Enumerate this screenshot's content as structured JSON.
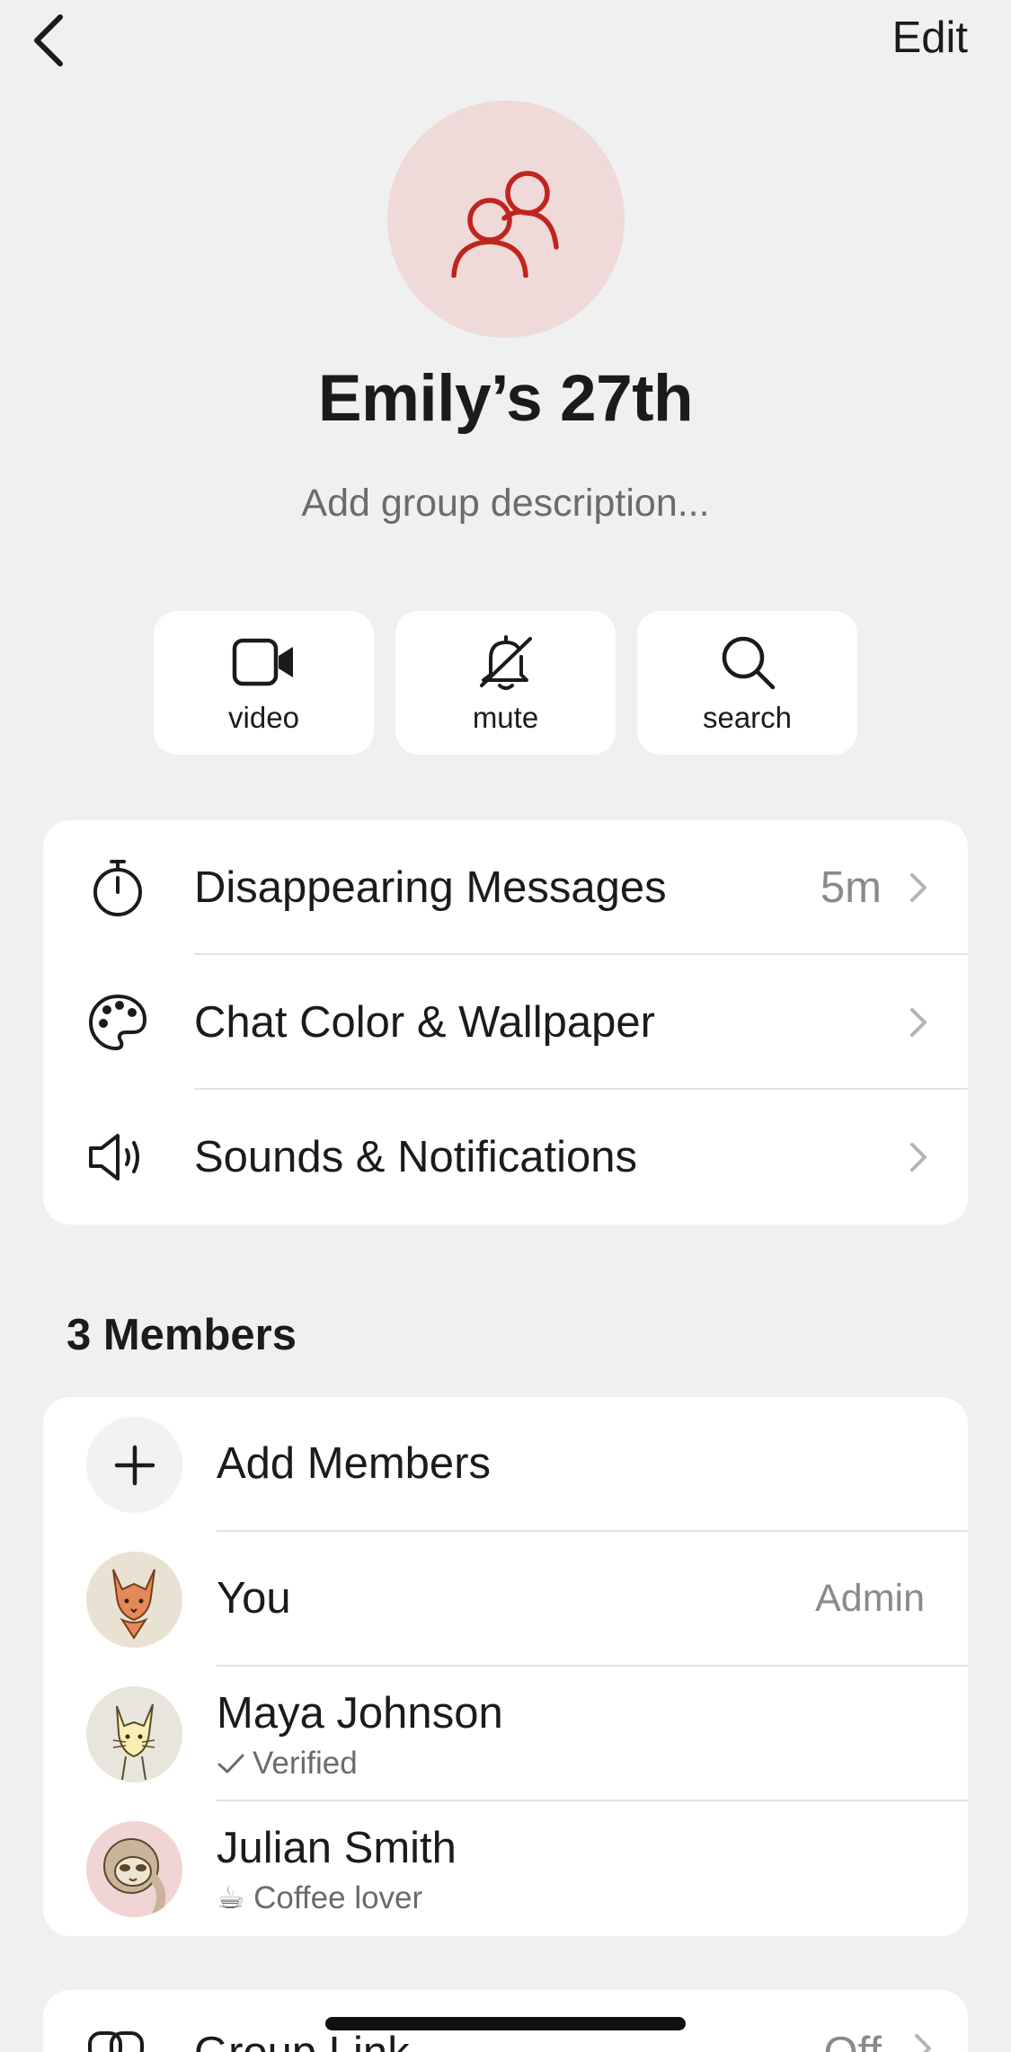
{
  "nav": {
    "edit_label": "Edit"
  },
  "group": {
    "title": "Emily’s 27th",
    "description_placeholder": "Add group description...",
    "avatar_color": "#efd9d9",
    "accent_color": "#c0251d"
  },
  "actions": [
    {
      "label": "video",
      "icon": "video-camera-icon"
    },
    {
      "label": "mute",
      "icon": "bell-slash-icon"
    },
    {
      "label": "search",
      "icon": "search-icon"
    }
  ],
  "settings": [
    {
      "label": "Disappearing Messages",
      "value": "5m",
      "icon": "timer-icon"
    },
    {
      "label": "Chat Color & Wallpaper",
      "value": "",
      "icon": "palette-icon"
    },
    {
      "label": "Sounds & Notifications",
      "value": "",
      "icon": "speaker-icon"
    }
  ],
  "members": {
    "header": "3 Members",
    "add_label": "Add Members",
    "list": [
      {
        "name": "You",
        "role": "Admin",
        "subtitle": "",
        "avatar": "fox-avatar"
      },
      {
        "name": "Maya Johnson",
        "role": "",
        "subtitle": "Verified",
        "avatar": "cat-avatar"
      },
      {
        "name": "Julian Smith",
        "role": "",
        "subtitle": "☕ Coffee lover",
        "avatar": "sloth-avatar"
      }
    ]
  },
  "group_link": {
    "label": "Group Link",
    "value": "Off"
  }
}
